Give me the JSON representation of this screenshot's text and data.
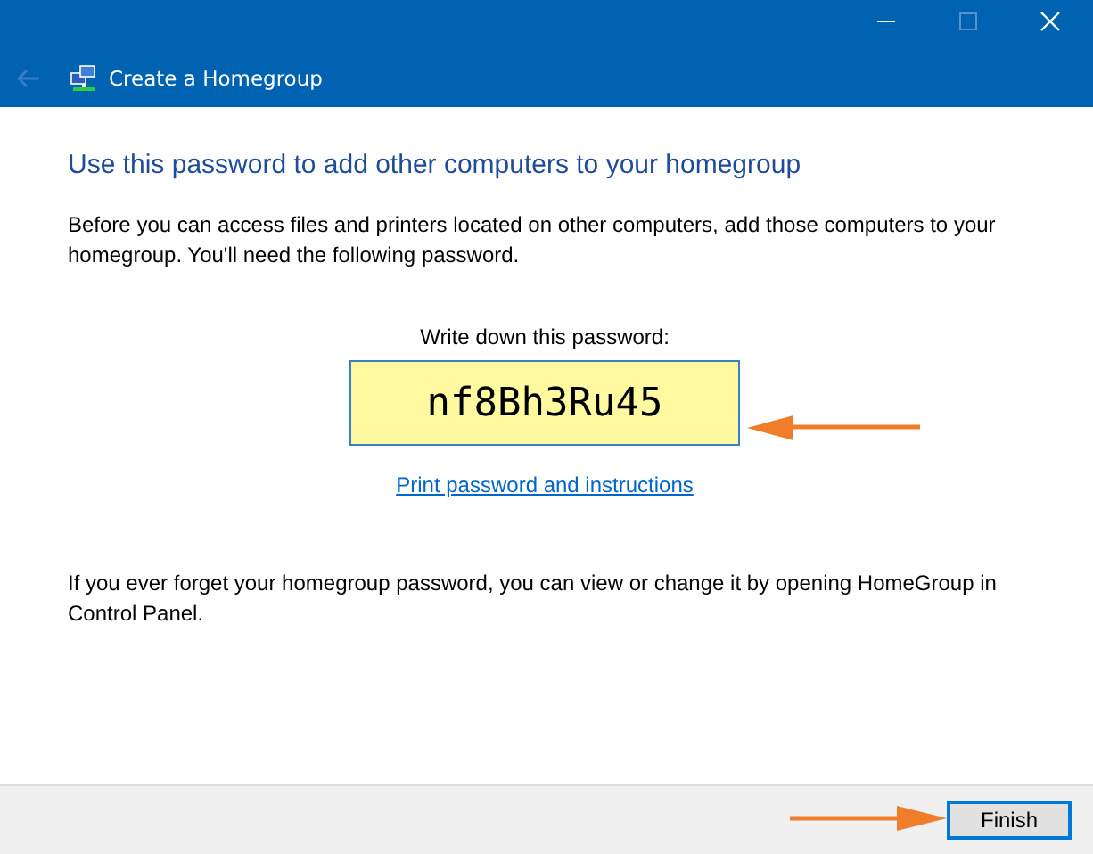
{
  "window": {
    "title": "Create a Homegroup"
  },
  "heading": "Use this password to add other computers to your homegroup",
  "intro": "Before you can access files and printers located on other computers, add those computers to your homegroup. You'll need the following password.",
  "password_label": "Write down this password:",
  "password": "nf8Bh3Ru45",
  "print_link": "Print password and instructions",
  "note": "If you ever forget your homegroup password, you can view or change it by opening HomeGroup in Control Panel.",
  "buttons": [
    "Finish"
  ]
}
